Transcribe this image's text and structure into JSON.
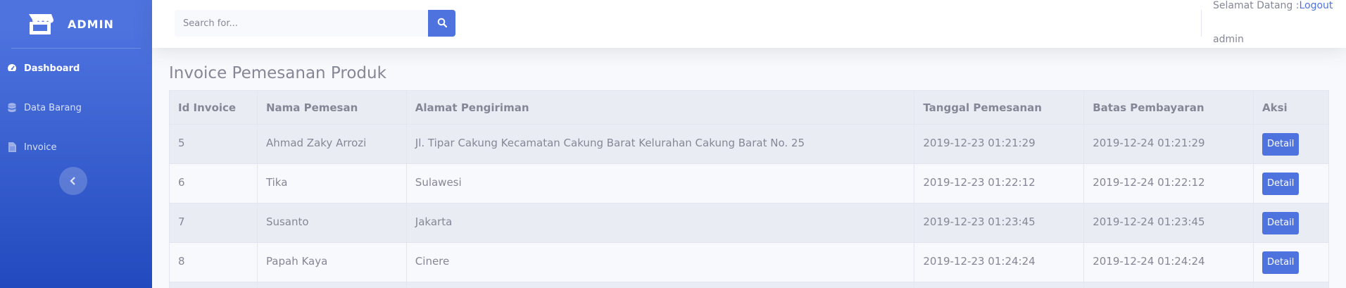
{
  "sidebar": {
    "brand": "ADMIN",
    "items": [
      {
        "label": "Dashboard",
        "icon": "tachometer-icon"
      },
      {
        "label": "Data Barang",
        "icon": "database-icon"
      },
      {
        "label": "Invoice",
        "icon": "file-icon"
      }
    ]
  },
  "topbar": {
    "search_placeholder": "Search for...",
    "welcome_text": "Selamat Datang :",
    "logout_label": "Logout",
    "username": "admin"
  },
  "page": {
    "title": "Invoice Pemesanan Produk"
  },
  "table": {
    "headers": [
      "Id Invoice",
      "Nama Pemesan",
      "Alamat Pengiriman",
      "Tanggal Pemesanan",
      "Batas Pembayaran",
      "Aksi"
    ],
    "rows": [
      {
        "id": "5",
        "nama": "Ahmad Zaky Arrozi",
        "alamat": "Jl. Tipar Cakung Kecamatan Cakung Barat Kelurahan Cakung Barat No. 25",
        "tanggal": "2019-12-23 01:21:29",
        "batas": "2019-12-24 01:21:29",
        "aksi": "Detail"
      },
      {
        "id": "6",
        "nama": "Tika",
        "alamat": "Sulawesi",
        "tanggal": "2019-12-23 01:22:12",
        "batas": "2019-12-24 01:22:12",
        "aksi": "Detail"
      },
      {
        "id": "7",
        "nama": "Susanto",
        "alamat": "Jakarta",
        "tanggal": "2019-12-23 01:23:45",
        "batas": "2019-12-24 01:23:45",
        "aksi": "Detail"
      },
      {
        "id": "8",
        "nama": "Papah Kaya",
        "alamat": "Cinere",
        "tanggal": "2019-12-23 01:24:24",
        "batas": "2019-12-24 01:24:24",
        "aksi": "Detail"
      }
    ]
  },
  "colors": {
    "primary": "#4e73df",
    "sidebar_dark": "#224abe",
    "text": "#858796"
  }
}
